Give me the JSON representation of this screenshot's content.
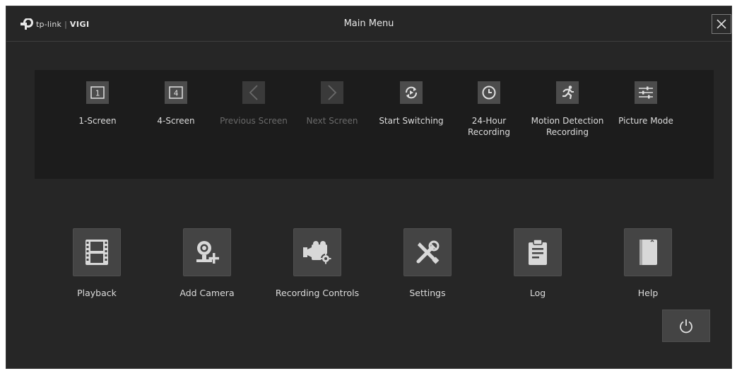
{
  "window": {
    "title": "Main Menu",
    "logo": {
      "brand": "tp-link",
      "separator": "|",
      "product": "VIGI"
    }
  },
  "toolbar": {
    "items": [
      {
        "label": "1-Screen",
        "icon": "one-screen-icon",
        "enabled": true
      },
      {
        "label": "4-Screen",
        "icon": "four-screen-icon",
        "enabled": true
      },
      {
        "label": "Previous Screen",
        "icon": "chevron-left-icon",
        "enabled": false
      },
      {
        "label": "Next Screen",
        "icon": "chevron-right-icon",
        "enabled": false
      },
      {
        "label": "Start Switching",
        "icon": "switching-icon",
        "enabled": true
      },
      {
        "label": "24-Hour\nRecording",
        "icon": "clock-icon",
        "enabled": true
      },
      {
        "label": "Motion Detection\nRecording",
        "icon": "running-person-icon",
        "enabled": true
      },
      {
        "label": "Picture Mode",
        "icon": "sliders-icon",
        "enabled": true
      }
    ],
    "one_screen_glyph": "1",
    "four_screen_glyph": "4"
  },
  "apps": [
    {
      "label": "Playback",
      "icon": "film-icon"
    },
    {
      "label": "Add Camera",
      "icon": "add-camera-icon"
    },
    {
      "label": "Recording Controls",
      "icon": "recording-camera-icon"
    },
    {
      "label": "Settings",
      "icon": "tools-icon"
    },
    {
      "label": "Log",
      "icon": "clipboard-icon"
    },
    {
      "label": "Help",
      "icon": "book-icon"
    }
  ],
  "colors": {
    "background": "#262626",
    "panel": "#1c1c1c",
    "button": "#444444",
    "text": "#dcdcdc",
    "disabled_text": "#6a6a6a"
  }
}
